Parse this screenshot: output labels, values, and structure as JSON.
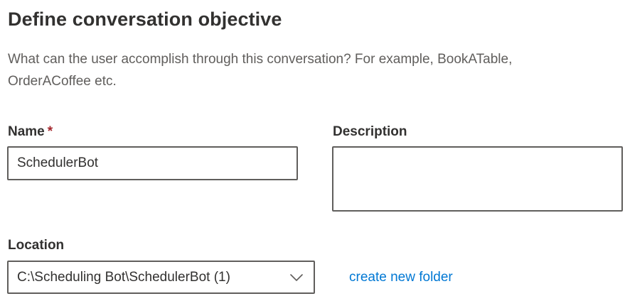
{
  "header": {
    "title": "Define conversation objective",
    "subtitle": "What can the user accomplish through this conversation? For example, BookATable, OrderACoffee etc."
  },
  "form": {
    "name": {
      "label": "Name",
      "required_marker": "*",
      "value": "SchedulerBot"
    },
    "description": {
      "label": "Description",
      "value": ""
    },
    "location": {
      "label": "Location",
      "selected": "C:\\Scheduling Bot\\SchedulerBot (1)",
      "icon": "chevron-down-icon"
    },
    "create_folder_link": "create new folder"
  },
  "colors": {
    "text": "#323130",
    "subtle_text": "#605e5c",
    "border": "#605e5c",
    "required": "#a4262c",
    "link": "#0078d4"
  }
}
